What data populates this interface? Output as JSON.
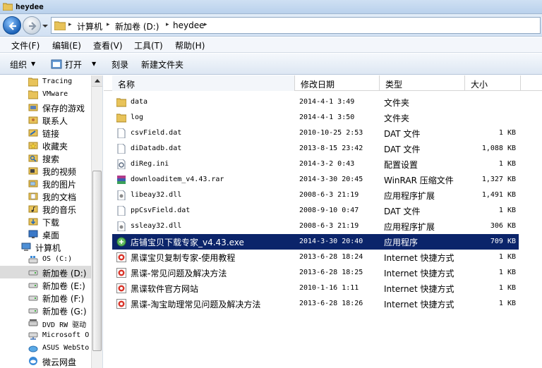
{
  "window": {
    "title": "heydee"
  },
  "address": {
    "crumbs": [
      "计算机",
      "新加卷 (D:)",
      "heydee"
    ]
  },
  "menu": [
    "文件(F)",
    "编辑(E)",
    "查看(V)",
    "工具(T)",
    "帮助(H)"
  ],
  "commands": {
    "organize": "组织",
    "open": "打开",
    "burn": "刻录",
    "new_folder": "新建文件夹"
  },
  "navigation": [
    {
      "label": "Tracing",
      "icon": "folder-icon"
    },
    {
      "label": "VMware",
      "icon": "folder-icon"
    },
    {
      "label": "保存的游戏",
      "icon": "saved-games-icon"
    },
    {
      "label": "联系人",
      "icon": "contacts-icon"
    },
    {
      "label": "链接",
      "icon": "links-icon"
    },
    {
      "label": "收藏夹",
      "icon": "favorites-icon"
    },
    {
      "label": "搜索",
      "icon": "searches-icon"
    },
    {
      "label": "我的视频",
      "icon": "videos-icon"
    },
    {
      "label": "我的图片",
      "icon": "pictures-icon"
    },
    {
      "label": "我的文档",
      "icon": "documents-icon"
    },
    {
      "label": "我的音乐",
      "icon": "music-icon"
    },
    {
      "label": "下载",
      "icon": "downloads-icon"
    },
    {
      "label": "桌面",
      "icon": "desktop-icon"
    },
    {
      "label": "计算机",
      "icon": "computer-icon"
    },
    {
      "label": "OS (C:)",
      "icon": "system-drive-icon"
    },
    {
      "label": "新加卷 (D:)",
      "icon": "drive-icon",
      "selected": true
    },
    {
      "label": "新加卷 (E:)",
      "icon": "drive-icon"
    },
    {
      "label": "新加卷 (F:)",
      "icon": "drive-icon"
    },
    {
      "label": "新加卷 (G:)",
      "icon": "drive-icon"
    },
    {
      "label": "DVD RW 驱动",
      "icon": "dvd-drive-icon"
    },
    {
      "label": "Microsoft O",
      "icon": "network-drive-icon"
    },
    {
      "label": "ASUS WebSto",
      "icon": "cloud-storage-icon"
    },
    {
      "label": "微云网盘",
      "icon": "weiyun-icon"
    }
  ],
  "columns": {
    "name": "名称",
    "date": "修改日期",
    "type": "类型",
    "size": "大小"
  },
  "files": [
    {
      "name": "data",
      "date": "2014-4-1 3:49",
      "type": "文件夹",
      "size": "",
      "icon": "folder-icon"
    },
    {
      "name": "log",
      "date": "2014-4-1 3:50",
      "type": "文件夹",
      "size": "",
      "icon": "folder-icon"
    },
    {
      "name": "csvField.dat",
      "date": "2010-10-25 2:53",
      "type": "DAT 文件",
      "size": "1 KB",
      "icon": "file-icon"
    },
    {
      "name": "diDatadb.dat",
      "date": "2013-8-15 23:42",
      "type": "DAT 文件",
      "size": "1,088 KB",
      "icon": "file-icon"
    },
    {
      "name": "diReg.ini",
      "date": "2014-3-2 0:43",
      "type": "配置设置",
      "size": "1 KB",
      "icon": "ini-file-icon"
    },
    {
      "name": "downloaditem_v4.43.rar",
      "date": "2014-3-30 20:45",
      "type": "WinRAR 压缩文件",
      "size": "1,327 KB",
      "icon": "rar-icon"
    },
    {
      "name": "libeay32.dll",
      "date": "2008-6-3 21:19",
      "type": "应用程序扩展",
      "size": "1,491 KB",
      "icon": "dll-icon"
    },
    {
      "name": "ppCsvField.dat",
      "date": "2008-9-10 0:47",
      "type": "DAT 文件",
      "size": "1 KB",
      "icon": "file-icon"
    },
    {
      "name": "ssleay32.dll",
      "date": "2008-6-3 21:19",
      "type": "应用程序扩展",
      "size": "306 KB",
      "icon": "dll-icon"
    },
    {
      "name": "店铺宝贝下载专家_v4.43.exe",
      "date": "2014-3-30 20:40",
      "type": "应用程序",
      "size": "709 KB",
      "icon": "app-exe-icon",
      "selected": true
    },
    {
      "name": "黑谍宝贝复制专家-使用教程",
      "date": "2013-6-28 18:24",
      "type": "Internet 快捷方式",
      "size": "1 KB",
      "icon": "internet-shortcut-icon"
    },
    {
      "name": "黑谍-常见问题及解决方法",
      "date": "2013-6-28 18:25",
      "type": "Internet 快捷方式",
      "size": "1 KB",
      "icon": "internet-shortcut-icon"
    },
    {
      "name": "黑谍软件官方网站",
      "date": "2010-1-16 1:11",
      "type": "Internet 快捷方式",
      "size": "1 KB",
      "icon": "internet-shortcut-icon"
    },
    {
      "name": "黑谍-淘宝助理常见问题及解决方法",
      "date": "2013-6-28 18:26",
      "type": "Internet 快捷方式",
      "size": "1 KB",
      "icon": "internet-shortcut-icon"
    }
  ]
}
